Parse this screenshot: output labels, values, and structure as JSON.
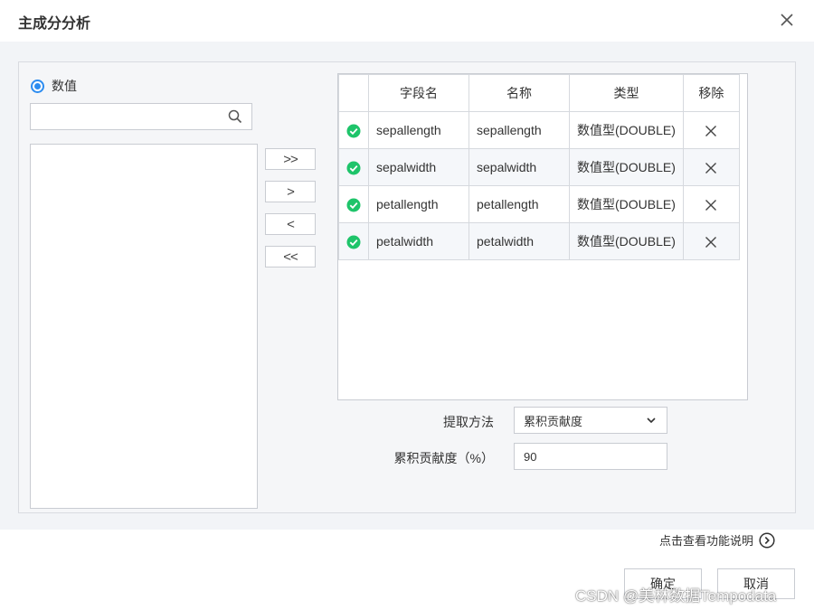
{
  "dialog": {
    "title": "主成分分析",
    "close_icon": "close-icon"
  },
  "source": {
    "radio_label": "数值",
    "search_placeholder": "",
    "search_icon": "search-icon"
  },
  "move_buttons": [
    {
      "label": ">>"
    },
    {
      "label": ">"
    },
    {
      "label": "<"
    },
    {
      "label": "<<"
    }
  ],
  "fields_table": {
    "headers": [
      "",
      "字段名",
      "名称",
      "类型",
      "移除"
    ],
    "rows": [
      {
        "field": "sepallength",
        "name": "sepallength",
        "type": "数值型(DOUBLE)"
      },
      {
        "field": "sepalwidth",
        "name": "sepalwidth",
        "type": "数值型(DOUBLE)"
      },
      {
        "field": "petallength",
        "name": "petallength",
        "type": "数值型(DOUBLE)"
      },
      {
        "field": "petalwidth",
        "name": "petalwidth",
        "type": "数值型(DOUBLE)"
      }
    ],
    "check_color": "#1ec46a",
    "remove_icon": "x-icon"
  },
  "form": {
    "method_label": "提取方法",
    "method_value": "累积贡献度",
    "contribution_label": "累积贡献度（%）",
    "contribution_value": "90"
  },
  "help_link": {
    "label": "点击查看功能说明",
    "icon": "chevron-right-circle-icon"
  },
  "footer": {
    "confirm_label": "确定",
    "cancel_label": "取消"
  },
  "watermark": "CSDN @美林数据Tempodata",
  "colors": {
    "accent": "#2d8cf0",
    "panel_bg": "#f2f4f7",
    "border": "#c9ccd2"
  }
}
